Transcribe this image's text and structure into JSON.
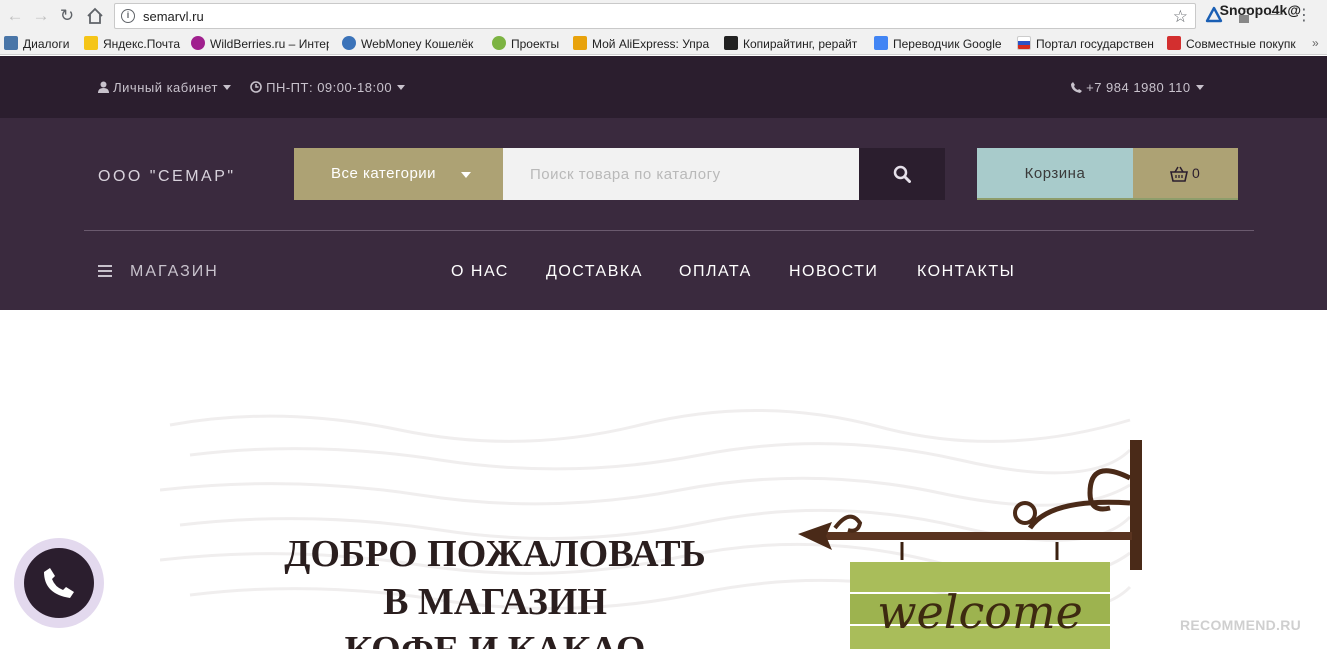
{
  "browser": {
    "url": "semarvl.ru",
    "profile_name": "Snoopo4k@",
    "bookmarks": [
      {
        "label": "Диалоги",
        "icon": "vk-icon",
        "color": "#4a76a8"
      },
      {
        "label": "Яндекс.Почта",
        "icon": "mail-icon",
        "color": "#f5c518"
      },
      {
        "label": "WildBerries.ru – Интер",
        "icon": "wildberries-icon",
        "color": "#a0208e"
      },
      {
        "label": "WebMoney Кошелёк",
        "icon": "globe-icon",
        "color": "#3b73b9"
      },
      {
        "label": "Проекты",
        "icon": "sparkle-icon",
        "color": "#7cb342"
      },
      {
        "label": "Мой AliExpress: Упра",
        "icon": "aliexpress-icon",
        "color": "#e8a20c"
      },
      {
        "label": "Копирайтинг, рерайт",
        "icon": "letter-a-icon",
        "color": "#222222"
      },
      {
        "label": "Переводчик Google",
        "icon": "translate-icon",
        "color": "#4285f4"
      },
      {
        "label": "Портал государствен",
        "icon": "flag-icon",
        "color": "#d52b1e"
      },
      {
        "label": "Совместные покупк",
        "icon": "gift-icon",
        "color": "#d32f2f"
      }
    ]
  },
  "topbar": {
    "account_label": "Личный кабинет",
    "hours_label": "ПН-ПТ: 09:00-18:00",
    "phone_label": "+7 984 1980 110"
  },
  "header": {
    "logo": "ООО \"СЕМАР\"",
    "category_label": "Все категории",
    "search_placeholder": "Поиск товара по каталогу",
    "cart_label": "Корзина",
    "cart_count": "0"
  },
  "nav": {
    "shop_label": "МАГАЗИН",
    "links": [
      "О НАС",
      "ДОСТАВКА",
      "ОПЛАТА",
      "НОВОСТИ",
      "КОНТАКТЫ"
    ]
  },
  "hero": {
    "line1": "ДОБРО ПОЖАЛОВАТЬ",
    "line2": "В МАГАЗИН",
    "line3": "КОФЕ И КАКАО",
    "sign_text": "welcome"
  },
  "watermark": "RECOMMEND.RU",
  "colors": {
    "topbar_bg": "#2b1e2e",
    "header_bg": "#3a2a3e",
    "accent_gold": "#ada274",
    "accent_teal": "#a8cbcb"
  }
}
